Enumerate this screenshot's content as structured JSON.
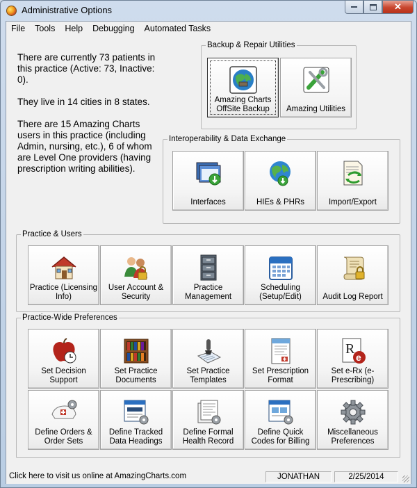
{
  "window": {
    "title": "Administrative Options"
  },
  "menu": [
    "File",
    "Tools",
    "Help",
    "Debugging",
    "Automated Tasks"
  ],
  "info": {
    "patients": "There are currently 73 patients in this practice (Active: 73, Inactive: 0).",
    "cities": "They live in 14 cities in 8 states.",
    "users": "There are 15 Amazing Charts users in this practice (including Admin, nursing, etc.), 6 of whom are Level One providers (having prescription writing abilities)."
  },
  "backup": {
    "legend": "Backup & Repair Utilities",
    "offsite": "Amazing Charts OffSite Backup",
    "utilities": "Amazing Utilities"
  },
  "interop": {
    "legend": "Interoperability & Data Exchange",
    "interfaces": "Interfaces",
    "hies": "HIEs & PHRs",
    "import_export": "Import/Export"
  },
  "practice": {
    "legend": "Practice & Users",
    "licensing": "Practice (Licensing Info)",
    "user_account": "User Account & Security",
    "management": "Practice Management",
    "scheduling": "Scheduling (Setup/Edit)",
    "audit_log": "Audit Log Report"
  },
  "preferences": {
    "legend": "Practice-Wide Preferences",
    "decision_support": "Set Decision Support",
    "documents": "Set Practice Documents",
    "templates": "Set Practice Templates",
    "prescription_format": "Set Prescription Format",
    "erx": "Set e-Rx (e-Prescribing)",
    "orders": "Define Orders & Order Sets",
    "tracked_data": "Define Tracked Data Headings",
    "formal_record": "Define Formal Health Record",
    "quick_codes": "Define Quick Codes for Billing",
    "misc": "Miscellaneous Preferences"
  },
  "status": {
    "link": "Click here to visit us online at AmazingCharts.com",
    "user": "JONATHAN",
    "date": "2/25/2014"
  }
}
